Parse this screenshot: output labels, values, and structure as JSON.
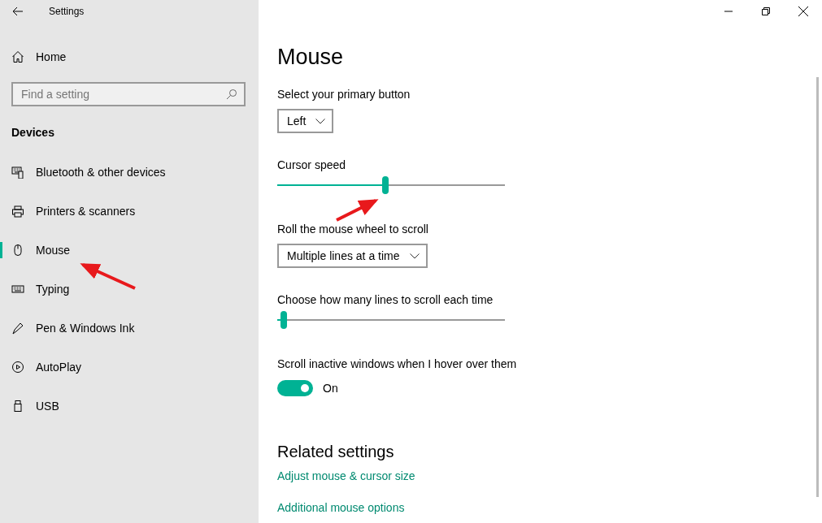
{
  "window": {
    "title": "Settings"
  },
  "sidebar": {
    "home": "Home",
    "search": {
      "placeholder": "Find a setting"
    },
    "section": "Devices",
    "items": [
      {
        "label": "Bluetooth & other devices",
        "selected": false
      },
      {
        "label": "Printers & scanners",
        "selected": false
      },
      {
        "label": "Mouse",
        "selected": true
      },
      {
        "label": "Typing",
        "selected": false
      },
      {
        "label": "Pen & Windows Ink",
        "selected": false
      },
      {
        "label": "AutoPlay",
        "selected": false
      },
      {
        "label": "USB",
        "selected": false
      }
    ]
  },
  "page": {
    "title": "Mouse",
    "settings": [
      {
        "kind": "dropdown",
        "label": "Select your primary button",
        "value": "Left"
      },
      {
        "kind": "slider",
        "label": "Cursor speed",
        "level": 0.475
      },
      {
        "kind": "dropdown",
        "label": "Roll the mouse wheel to scroll",
        "value": "Multiple lines at a time"
      },
      {
        "kind": "slider",
        "label": "Choose how many lines to scroll each time",
        "level": 0.03
      },
      {
        "kind": "toggle",
        "label": "Scroll inactive windows when I hover over them",
        "on": true,
        "state_text": "On"
      }
    ],
    "related": {
      "title": "Related settings",
      "links": [
        "Adjust mouse & cursor size",
        "Additional mouse options"
      ]
    }
  }
}
